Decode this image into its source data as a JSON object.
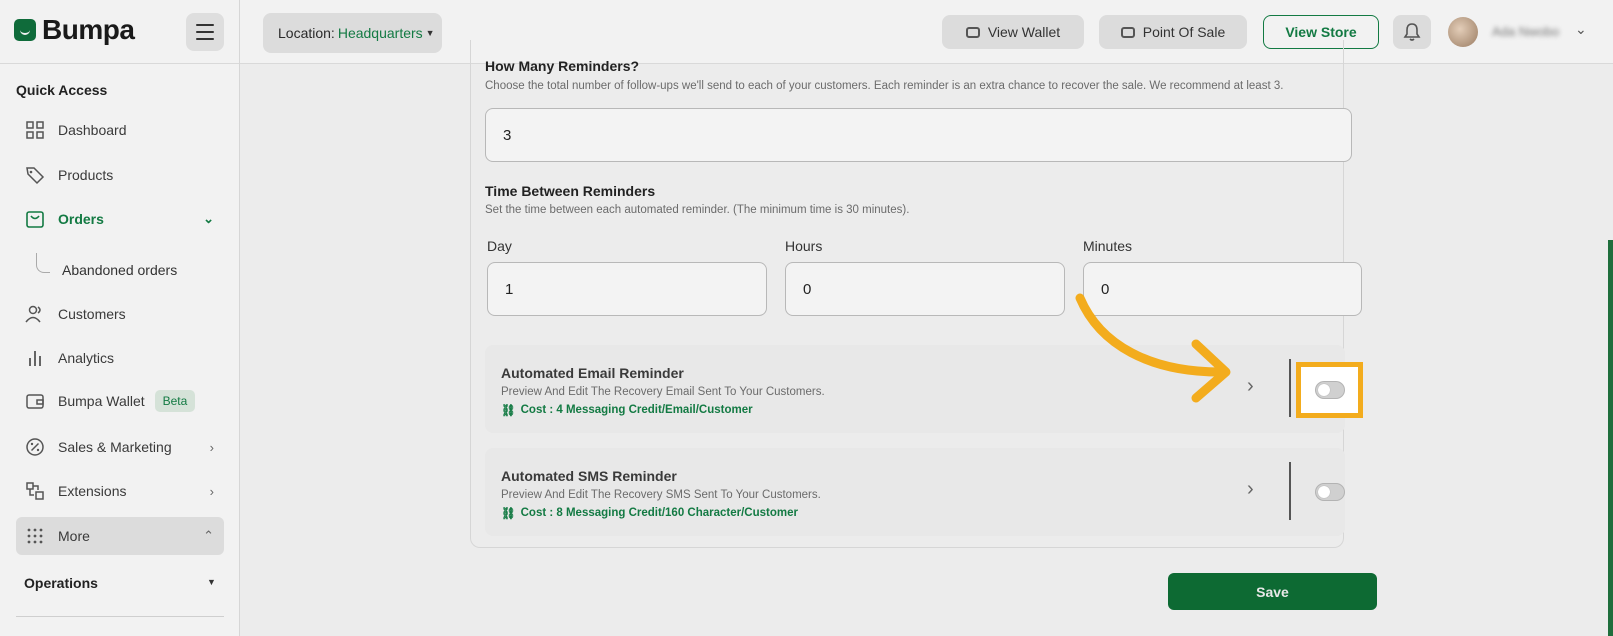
{
  "app": {
    "brand": "Bumpa",
    "location_label": "Location:",
    "location_value": "Headquarters"
  },
  "topbar": {
    "view_wallet": "View Wallet",
    "point_of_sale": "Point Of Sale",
    "view_store": "View Store",
    "user_name": "Ada Nwobo"
  },
  "sidebar": {
    "quick_access": "Quick Access",
    "items": [
      {
        "label": "Dashboard",
        "icon": "grid-icon"
      },
      {
        "label": "Products",
        "icon": "tag-icon"
      },
      {
        "label": "Orders",
        "icon": "bag-icon",
        "active": true
      },
      {
        "label": "Abandoned orders"
      },
      {
        "label": "Customers",
        "icon": "users-icon"
      },
      {
        "label": "Analytics",
        "icon": "bar-chart-icon"
      },
      {
        "label": "Bumpa Wallet",
        "icon": "wallet-icon",
        "badge": "Beta"
      },
      {
        "label": "Sales & Marketing",
        "icon": "percent-icon"
      },
      {
        "label": "Extensions",
        "icon": "extensions-icon"
      },
      {
        "label": "More",
        "icon": "dots-grid-icon"
      }
    ],
    "operations": "Operations"
  },
  "form": {
    "reminders_title": "How Many Reminders?",
    "reminders_desc": "Choose the total number of follow-ups we'll send to each of your customers. Each reminder is an extra chance to recover the sale. We recommend at least 3.",
    "reminders_value": "3",
    "time_title": "Time Between Reminders",
    "time_desc": "Set the time between each automated reminder. (The minimum time is 30 minutes).",
    "day_label": "Day",
    "day_value": "1",
    "hours_label": "Hours",
    "hours_value": "0",
    "minutes_label": "Minutes",
    "minutes_value": "0"
  },
  "reminders": {
    "email": {
      "title": "Automated Email Reminder",
      "desc": "Preview And Edit The Recovery Email Sent To Your Customers.",
      "cost": "Cost : 4 Messaging Credit/Email/Customer",
      "enabled": false
    },
    "sms": {
      "title": "Automated SMS Reminder",
      "desc": "Preview And Edit The Recovery SMS Sent To Your Customers.",
      "cost": "Cost : 8 Messaging Credit/160 Character/Customer",
      "enabled": false
    }
  },
  "actions": {
    "save": "Save"
  },
  "colors": {
    "brand_green": "#137a43",
    "highlight": "#f3ac1d"
  }
}
